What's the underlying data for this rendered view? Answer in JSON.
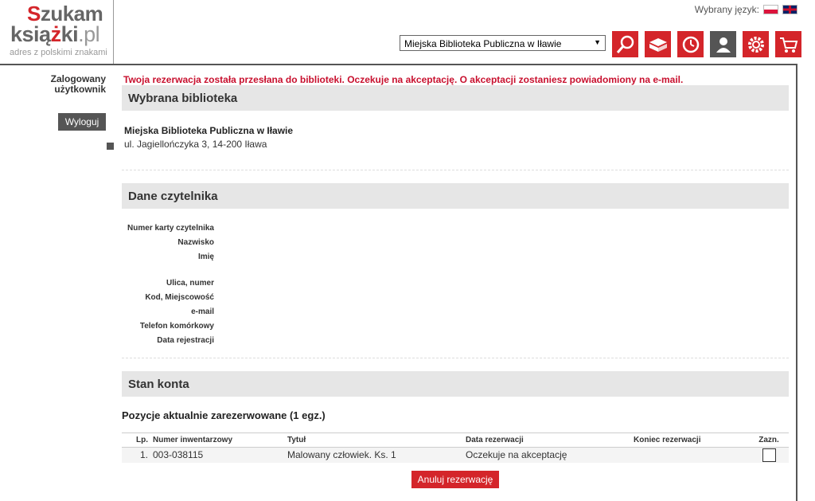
{
  "logo": {
    "line1_accent": "S",
    "line1": "zukam",
    "line2_a": "ksią",
    "line2_accent": "ż",
    "line2_b": "ki",
    "line2_suffix": ".pl",
    "tagline": "adres z polskimi znakami"
  },
  "header": {
    "language_label": "Wybrany język:",
    "library_select": "Miejska Biblioteka Publiczna w Iławie",
    "toolbar_icons": [
      "search-icon",
      "books-icon",
      "history-icon",
      "user-icon",
      "settings-icon",
      "cart-icon"
    ]
  },
  "sidebar": {
    "logged_in_line1": "Zalogowany",
    "logged_in_line2": "użytkownik",
    "logout": "Wyloguj"
  },
  "notice": "Twoja rezerwacja została przesłana do biblioteki. Oczekuje na akceptację. O akceptacji zostaniesz powiadomiony na e-mail.",
  "library_section": {
    "title": "Wybrana biblioteka",
    "name": "Miejska Biblioteka Publiczna w Iławie",
    "address": "ul. Jagiellończyka 3, 14-200 Iława"
  },
  "reader_section": {
    "title": "Dane czytelnika",
    "fields": {
      "card": "Numer karty czytelnika",
      "surname": "Nazwisko",
      "name": "Imię",
      "street": "Ulica, numer",
      "city": "Kod, Miejscowość",
      "email": "e-mail",
      "phone": "Telefon komórkowy",
      "reg_date": "Data rejestracji"
    }
  },
  "account_section": {
    "title": "Stan konta",
    "subheading": "Pozycje aktualnie zarezerwowane (1 egz.)",
    "columns": {
      "lp": "Lp.",
      "inv": "Numer inwentarzowy",
      "title": "Tytuł",
      "date": "Data rezerwacji",
      "end": "Koniec rezerwacji",
      "sel": "Zazn."
    },
    "rows": [
      {
        "lp": "1.",
        "inv": "003-038115",
        "title": "Malowany człowiek. Ks. 1",
        "date": "Oczekuje na akceptację",
        "end": ""
      }
    ],
    "cancel_button": "Anuluj rezerwację"
  },
  "colors": {
    "accent": "#d4252a",
    "notice": "#c8102e",
    "section_bg": "#e6e6e6"
  }
}
